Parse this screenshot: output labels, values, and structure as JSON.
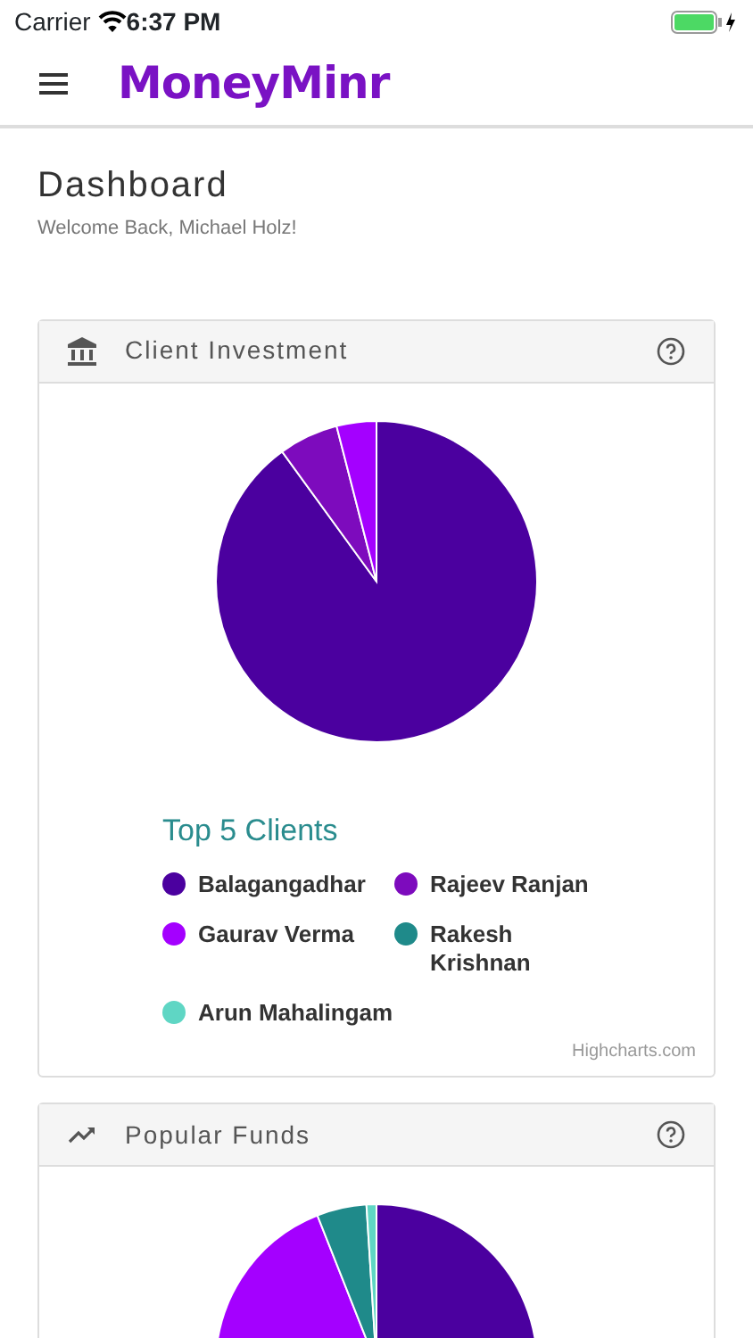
{
  "status_bar": {
    "carrier": "Carrier",
    "time": "6:37 PM"
  },
  "app_bar": {
    "logo": "MoneyMinr"
  },
  "page": {
    "title": "Dashboard",
    "subtitle": "Welcome Back, Michael Holz!"
  },
  "cards": [
    {
      "kind": "bank",
      "title": "Client Investment",
      "legend_title": "Top 5 Clients",
      "legend": [
        {
          "label": "Balagangadhar",
          "color": "#4b009f"
        },
        {
          "label": "Rajeev Ranjan",
          "color": "#7d0bbd"
        },
        {
          "label": "Gaurav Verma",
          "color": "#a400ff"
        },
        {
          "label": "Rakesh Krishnan",
          "color": "#1f8a8a"
        },
        {
          "label": "Arun Mahalingam",
          "color": "#5fd6c4"
        }
      ],
      "credit": "Highcharts.com"
    },
    {
      "kind": "trend",
      "title": "Popular Funds"
    }
  ]
}
